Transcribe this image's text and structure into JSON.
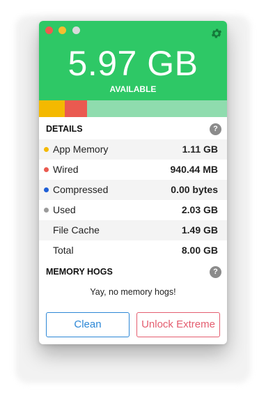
{
  "header": {
    "available_amount": "5.97 GB",
    "available_label": "AVAILABLE",
    "bg_color": "#2ec866"
  },
  "memory_bar": {
    "total_gb": 8.0,
    "segments": [
      {
        "name": "App Memory",
        "value_gb": 1.11,
        "color": "#f4b900"
      },
      {
        "name": "Wired",
        "value_gb": 0.94,
        "color": "#ea5a50"
      }
    ],
    "free_color": "#8fdcae"
  },
  "details": {
    "title": "DETAILS",
    "help": "?",
    "rows": [
      {
        "label": "App Memory",
        "value": "1.11 GB",
        "dot_color": "#f4b900"
      },
      {
        "label": "Wired",
        "value": "940.44 MB",
        "dot_color": "#ea5a50"
      },
      {
        "label": "Compressed",
        "value": "0.00 bytes",
        "dot_color": "#1f5fd6"
      },
      {
        "label": "Used",
        "value": "2.03 GB",
        "dot_color": "#9b9b9b"
      },
      {
        "label": "File Cache",
        "value": "1.49 GB",
        "dot_color": ""
      },
      {
        "label": "Total",
        "value": "8.00 GB",
        "dot_color": ""
      }
    ]
  },
  "hogs": {
    "title": "MEMORY HOGS",
    "help": "?",
    "message": "Yay, no memory hogs!"
  },
  "buttons": {
    "clean": "Clean",
    "unlock": "Unlock Extreme"
  },
  "icons": {
    "settings": "gear-icon",
    "help": "question-circle-icon"
  }
}
